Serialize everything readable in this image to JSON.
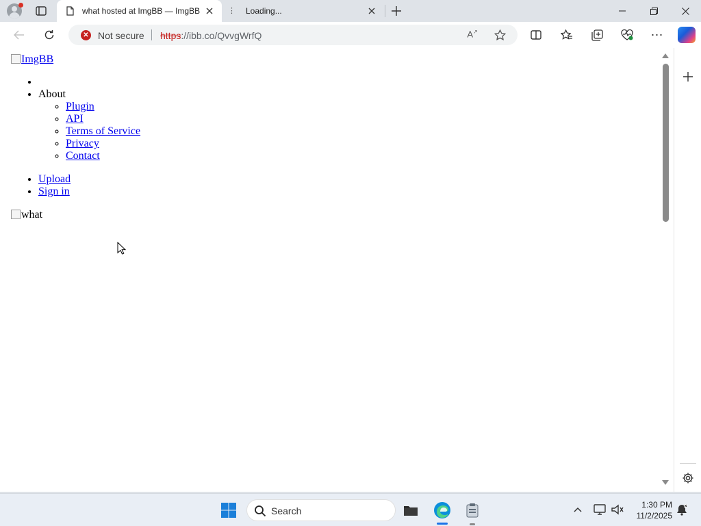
{
  "browser": {
    "tabs": [
      {
        "title": "what hosted at ImgBB — ImgBB",
        "active": true
      },
      {
        "title": "Loading...",
        "active": false
      }
    ],
    "address": {
      "security_text": "Not secure",
      "url_scheme": "https",
      "url_rest": "://ibb.co/QvvgWrfQ"
    }
  },
  "page": {
    "logo_alt": "ImgBB",
    "menu": {
      "about_label": "About",
      "about_links": [
        "Plugin",
        "API",
        "Terms of Service",
        "Privacy",
        "Contact"
      ],
      "upload_label": "Upload",
      "signin_label": "Sign in"
    },
    "main_image_alt": "what"
  },
  "taskbar": {
    "search_placeholder": "Search",
    "time": "1:30 PM",
    "date": "11/2/2025"
  },
  "colors": {
    "link": "#0000ee",
    "not_secure": "#c5221f",
    "edge_accent": "#1a73e8"
  },
  "icons": [
    "profile-icon",
    "tab-actions-icon",
    "page-icon",
    "close-icon",
    "plus-icon",
    "minimize-icon",
    "restore-icon",
    "back-icon",
    "reload-icon",
    "warning-icon",
    "read-aloud-icon",
    "star-icon",
    "split-screen-icon",
    "favorites-icon",
    "collections-icon",
    "performance-icon",
    "more-icon",
    "copilot-icon",
    "settings-icon",
    "windows-start-icon",
    "search-icon",
    "file-explorer-icon",
    "edge-icon",
    "network-icon",
    "volume-icon",
    "notification-icon"
  ]
}
